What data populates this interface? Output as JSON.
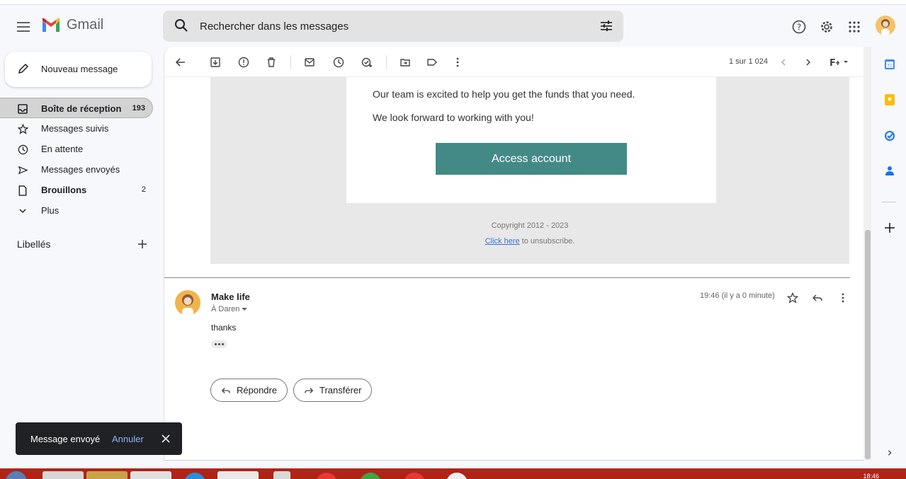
{
  "app": {
    "name": "Gmail"
  },
  "search": {
    "placeholder": "Rechercher dans les messages"
  },
  "compose": {
    "label": "Nouveau message"
  },
  "nav": {
    "items": [
      {
        "label": "Boîte de réception",
        "count": "193",
        "icon": "inbox-icon",
        "active": true,
        "bold": true
      },
      {
        "label": "Messages suivis",
        "count": "",
        "icon": "star-icon"
      },
      {
        "label": "En attente",
        "count": "",
        "icon": "clock-icon"
      },
      {
        "label": "Messages envoyés",
        "count": "",
        "icon": "send-icon"
      },
      {
        "label": "Brouillons",
        "count": "2",
        "icon": "draft-icon",
        "bold": true
      },
      {
        "label": "Plus",
        "count": "",
        "icon": "chevron-down-icon"
      }
    ],
    "labels_title": "Libellés"
  },
  "toolbar": {
    "pager": "1 sur 1 024"
  },
  "email": {
    "line1": "Our team is excited to help you get the funds that you need.",
    "line2": "We look forward to working with you!",
    "button": "Access account",
    "copyright": "Copyright 2012 - 2023",
    "unsub_link": "Click here",
    "unsub_rest": " to unsubscribe."
  },
  "message": {
    "sender": "Make life",
    "recipient": "À Daren",
    "time": "19:46 (il y a 0 minute)",
    "body": "thanks"
  },
  "actions": {
    "reply": "Répondre",
    "forward": "Transférer"
  },
  "toast": {
    "message": "Message envoyé",
    "undo": "Annuler"
  },
  "taskbar": {
    "time": "18:46"
  },
  "colors": {
    "accent": "#438a87",
    "toast_bg": "#202124",
    "link": "#8ab4f8"
  }
}
